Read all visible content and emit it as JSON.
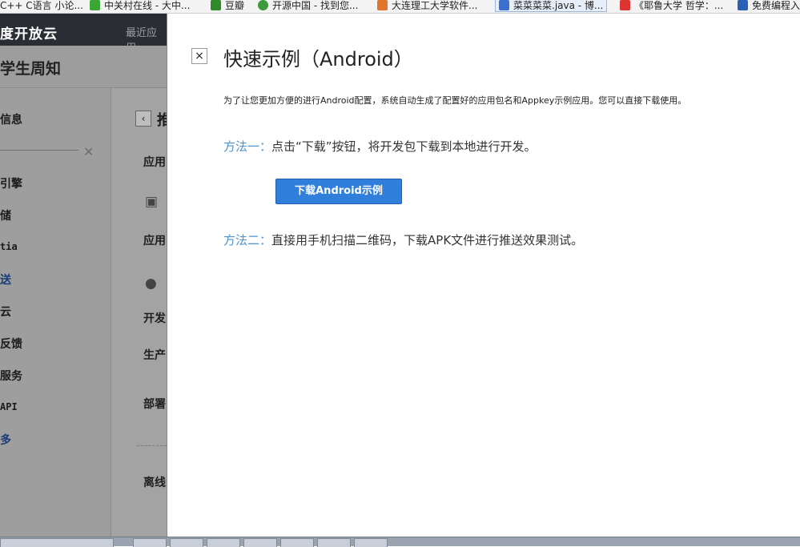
{
  "bookmarks": [
    {
      "label": "C++ C语言 小论...",
      "color": "#2a6fd6"
    },
    {
      "label": "中关村在线 - 大中...",
      "color": "#3aa635"
    },
    {
      "label": "豆瓣",
      "color": "#2f8a2c"
    },
    {
      "label": "开源中国 - 找到您...",
      "color": "#3e9a3a"
    },
    {
      "label": "大连理工大学软件...",
      "color": "#e0752b"
    },
    {
      "label": "菜菜菜菜.java - 博...",
      "color": "#3a6fd1"
    },
    {
      "label": "《耶鲁大学 哲学：...",
      "color": "#d33"
    },
    {
      "label": "免费编程入",
      "color": "#2a5fb7"
    }
  ],
  "header": {
    "brand": "度开放云",
    "recent": "最近应用"
  },
  "app": {
    "title": "学生周知"
  },
  "sidebar": {
    "items": [
      {
        "label": "信息"
      },
      {
        "label": "引擎"
      },
      {
        "label": "储"
      },
      {
        "label": "tia"
      },
      {
        "label": "送"
      },
      {
        "label": "云"
      },
      {
        "label": "反馈"
      },
      {
        "label": "服务"
      },
      {
        "label": "API"
      },
      {
        "label": "多"
      }
    ]
  },
  "content": {
    "back": "‹",
    "heading": "推",
    "labels": [
      "应用",
      "应用",
      "开发",
      "生产",
      "部署",
      "离线"
    ]
  },
  "modal": {
    "close": "×",
    "title": "快速示例（Android）",
    "description": "为了让您更加方便的进行Android配置，系统自动生成了配置好的应用包名和Appkey示例应用。您可以直接下载使用。",
    "method1_label": "方法一：",
    "method1_text": "点击“下载”按钮，将开发包下载到本地进行开发。",
    "download_button": "下载Android示例",
    "method2_label": "方法二：",
    "method2_text": "直接用手机扫描二维码，下载APK文件进行推送效果测试。"
  },
  "colors": {
    "accent": "#2f7fdb",
    "method_label": "#4f93cf",
    "overlay_nav": "#9e9e9e"
  }
}
